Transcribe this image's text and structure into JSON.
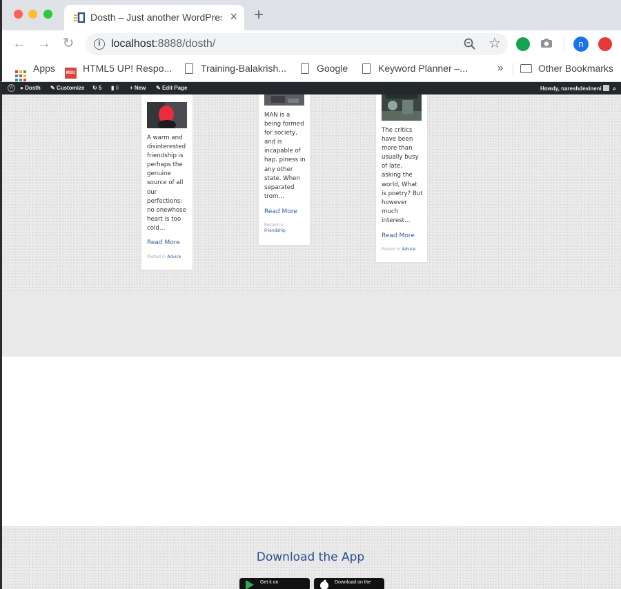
{
  "browser": {
    "tab_title": "Dosth – Just another WordPress",
    "tab_close": "×",
    "new_tab": "+",
    "url_host": "localhost",
    "url_rest": ":8888/dosth/",
    "avatar_letter": "n"
  },
  "bookmarks": {
    "items": [
      "Apps",
      "HTML5 UP! Respo...",
      "Training-Balakrish...",
      "Google",
      "Keyword Planner –..."
    ],
    "overflow": "»",
    "other": "Other Bookmarks",
    "msu_label": "MSU"
  },
  "wp_admin_bar": {
    "site": "Dosth",
    "customize": "Customize",
    "updates": "5",
    "comments": "0",
    "new": "New",
    "edit": "Edit Page",
    "howdy": "Howdy, nareshdevineni"
  },
  "posts": [
    {
      "excerpt": "A warm and disinterested friendship is perhaps the genuine source of all our perfections: no onewhose heart is too cold…",
      "read_more": "Read More",
      "posted_in": "Posted in",
      "category": "Advice"
    },
    {
      "excerpt": "MAN is a being formed for society, and is incapable of hap. piness in any other state. When separated trom…",
      "read_more": "Read More",
      "posted_in": "Posted in",
      "category": "Friendship"
    },
    {
      "excerpt": "The critics have been more than usually busy of late, asking the world, What is poetry? But however much interest…",
      "read_more": "Read More",
      "posted_in": "Posted in",
      "category": "Advice"
    }
  ],
  "footer": {
    "download_title": "Download the App",
    "google_play_small": "Get it on",
    "app_store_small": "Download on the"
  },
  "colors": {
    "link": "#2f5b9e",
    "admin_bar": "#23282d",
    "heading": "#2b4e8e"
  }
}
